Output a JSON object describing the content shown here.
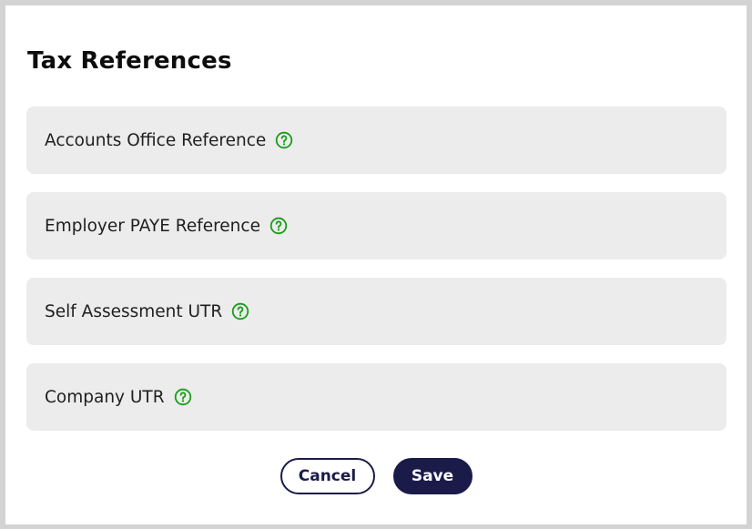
{
  "dialog": {
    "title": "Tax References"
  },
  "fields": [
    {
      "label": "Accounts Office Reference",
      "help_icon": "question-circle-icon"
    },
    {
      "label": "Employer PAYE Reference",
      "help_icon": "question-circle-icon"
    },
    {
      "label": "Self Assessment UTR",
      "help_icon": "question-circle-icon"
    },
    {
      "label": "Company UTR",
      "help_icon": "question-circle-icon"
    }
  ],
  "actions": {
    "cancel_label": "Cancel",
    "save_label": "Save"
  },
  "colors": {
    "help_icon": "#1a9c1a",
    "primary": "#1b1b4a",
    "field_bg": "#ececec",
    "backdrop": "#d3d3d3"
  }
}
